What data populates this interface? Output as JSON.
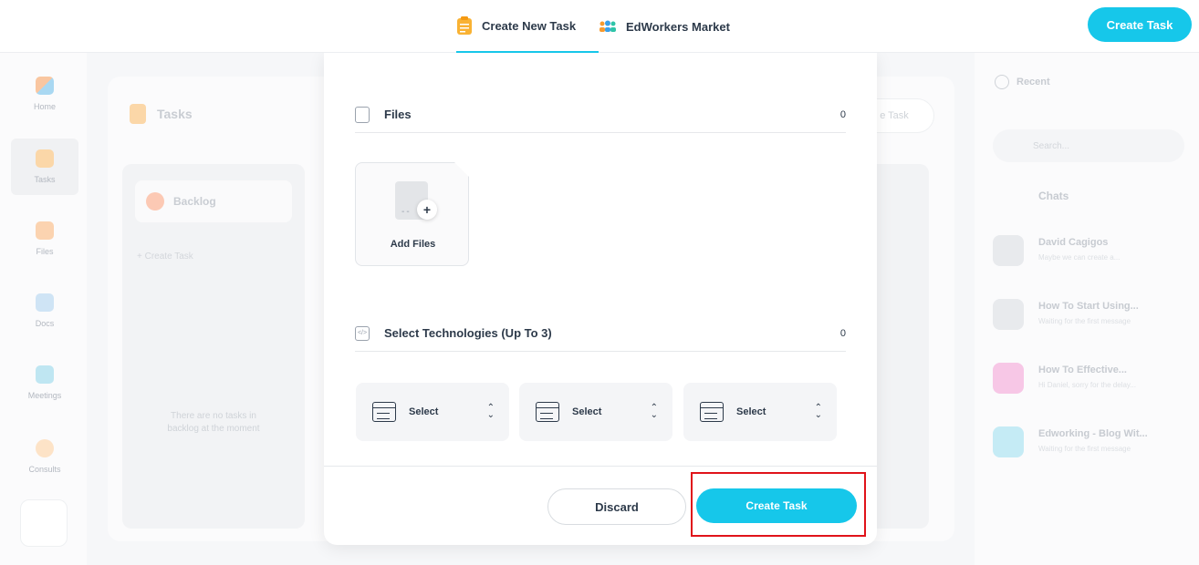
{
  "topbar": {
    "tabs": [
      {
        "label": "Create New Task",
        "icon": "clipboard-icon",
        "active": true
      },
      {
        "label": "EdWorkers Market",
        "icon": "people-icon",
        "active": false
      }
    ],
    "create_button": "Create Task",
    "accent": "#16c7ea"
  },
  "sidebar": {
    "items": [
      {
        "label": "Home",
        "icon": "grid-icon"
      },
      {
        "label": "Tasks",
        "icon": "clipboard-icon"
      },
      {
        "label": "Files",
        "icon": "folder-icon"
      },
      {
        "label": "Docs",
        "icon": "calendar-icon"
      },
      {
        "label": "Meetings",
        "icon": "video-icon"
      },
      {
        "label": "Consults",
        "icon": "sun-icon"
      }
    ]
  },
  "board": {
    "title": "Tasks",
    "column_title": "Backlog",
    "create_task_link": "+ Create Task",
    "empty_text": "There are no tasks in backlog at the moment",
    "header_button": "e Task"
  },
  "right_panel": {
    "tab": "Recent",
    "search_placeholder": "Search...",
    "chats_title": "Chats",
    "chats": [
      {
        "name": "David Cagigos",
        "preview": "Maybe we can create a..."
      },
      {
        "name": "How To Start Using...",
        "preview": "Waiting for the first message"
      },
      {
        "name": "How To Effective...",
        "preview": "Hi Daniel, sorry for the delay..."
      },
      {
        "name": "Edworking - Blog Wit...",
        "preview": "Waiting for the first message"
      }
    ]
  },
  "modal": {
    "files": {
      "label": "Files",
      "count": "0",
      "add_label": "Add Files"
    },
    "technologies": {
      "label": "Select Technologies (Up To 3)",
      "count": "0"
    },
    "selects": [
      "Select",
      "Select",
      "Select"
    ],
    "discard_button": "Discard",
    "create_button": "Create Task"
  }
}
